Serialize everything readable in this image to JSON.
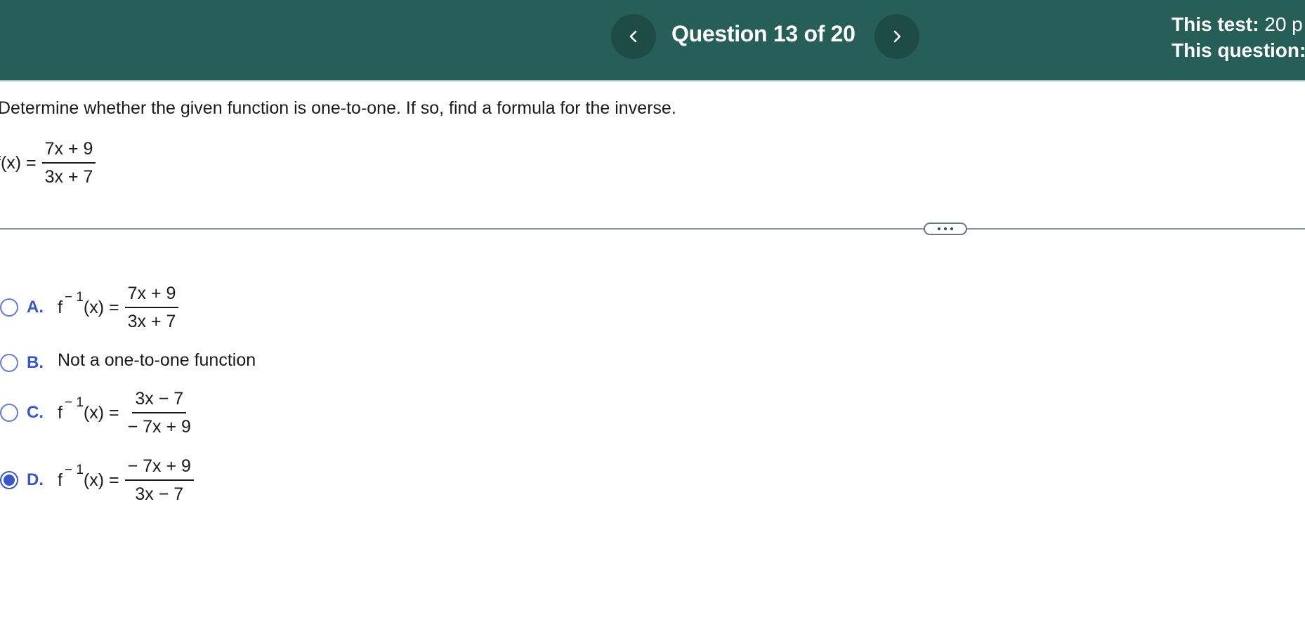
{
  "header": {
    "question_label": "Question 13 of 20",
    "score_test_label": "This test:",
    "score_test_value": "20 p",
    "score_question_label": "This question:",
    "prev_icon": "chevron-left-icon",
    "next_icon": "chevron-right-icon",
    "bg_color": "#275f58"
  },
  "question": {
    "prompt": "Determine whether the given function is one-to-one. If so, find a formula for the inverse.",
    "function_lhs": "f(x) =",
    "function_numerator": "7x + 9",
    "function_denominator": "3x + 7"
  },
  "options": [
    {
      "letter": "A.",
      "lhs_base": "f",
      "lhs_sup": "− 1",
      "lhs_tail": "(x) =",
      "numerator": "7x + 9",
      "denominator": "3x + 7",
      "selected": false
    },
    {
      "letter": "B.",
      "text": "Not a one-to-one function",
      "selected": false
    },
    {
      "letter": "C.",
      "lhs_base": "f",
      "lhs_sup": "− 1",
      "lhs_tail": "(x) =",
      "numerator": "3x − 7",
      "denominator": "− 7x + 9",
      "selected": false
    },
    {
      "letter": "D.",
      "lhs_base": "f",
      "lhs_sup": "− 1",
      "lhs_tail": "(x) =",
      "numerator": "− 7x + 9",
      "denominator": "3x − 7",
      "selected": true
    }
  ],
  "colors": {
    "accent": "#3a56c8",
    "header": "#275f58"
  }
}
